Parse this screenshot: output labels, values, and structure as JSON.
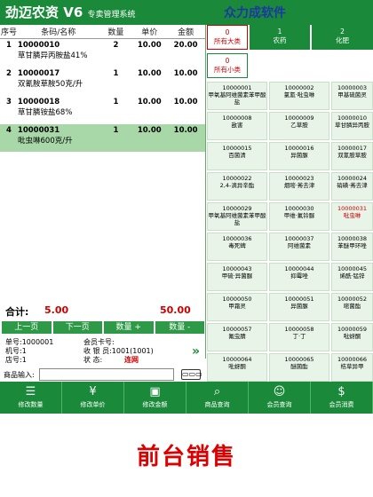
{
  "header": {
    "logo": "劲迈农资",
    "version": "V6",
    "system": "专卖管理系统",
    "brand": "众力成软件"
  },
  "table": {
    "columns": [
      "序号",
      "条码/名称",
      "数量",
      "单价",
      "金额"
    ],
    "rows": [
      {
        "seq": "1",
        "code": "10000010",
        "name": "草甘膦异丙胺盐41%",
        "qty": "2",
        "price": "10.00",
        "amount": "20.00"
      },
      {
        "seq": "2",
        "code": "10000017",
        "name": "双氰胺草胺50克/升",
        "qty": "1",
        "price": "10.00",
        "amount": "10.00"
      },
      {
        "seq": "3",
        "code": "10000018",
        "name": "草甘膦铵盐68%",
        "qty": "1",
        "price": "10.00",
        "amount": "10.00"
      },
      {
        "seq": "4",
        "code": "10000031",
        "name": "吡虫啉600克/升",
        "qty": "1",
        "price": "10.00",
        "amount": "10.00"
      }
    ]
  },
  "summary": {
    "label": "合计:",
    "qty": "5.00",
    "amount": "50.00"
  },
  "buttons": [
    "上一页",
    "下一页",
    "数量 +",
    "数量 -"
  ],
  "info": {
    "order": "单号:1000001",
    "machine": "机号:1",
    "store": "店号:1",
    "member_card": "会员卡号:",
    "cashier": "收 银 员:1001(1001)",
    "status_label": "状    态:",
    "status_value": "连网"
  },
  "input": {
    "label": "商品输入:",
    "keyboard": "▭▭▭"
  },
  "categories": [
    {
      "num": "0",
      "label": "所有大类"
    },
    {
      "num": "1",
      "label": "农药"
    },
    {
      "num": "2",
      "label": "化肥"
    }
  ],
  "subcategory": {
    "num": "0",
    "label": "所有小类"
  },
  "products": [
    {
      "code": "10000001",
      "name": "甲氧基阿维菌素苯甲酸盐"
    },
    {
      "code": "10000002",
      "name": "氯氰·吡虫啉"
    },
    {
      "code": "10000003",
      "name": "甲基硫菌灵"
    },
    {
      "code": "10000008",
      "name": "敌害"
    },
    {
      "code": "10000009",
      "name": "乙草胺"
    },
    {
      "code": "10000010",
      "name": "草甘膦异丙胺"
    },
    {
      "code": "10000015",
      "name": "百菌清"
    },
    {
      "code": "10000016",
      "name": "异菌脲"
    },
    {
      "code": "10000017",
      "name": "双氰胺草胺"
    },
    {
      "code": "10000022",
      "name": "2,4-滴异辛酯"
    },
    {
      "code": "10000023",
      "name": "烟嘧·莠去津"
    },
    {
      "code": "10000024",
      "name": "硝磺·莠去津"
    },
    {
      "code": "10000029",
      "name": "甲氧基阿维菌素苯甲酸盐"
    },
    {
      "code": "10000030",
      "name": "甲维·氟铃脲"
    },
    {
      "code": "10000031",
      "name": "吡虫啉"
    },
    {
      "code": "10000036",
      "name": "毒死蜱"
    },
    {
      "code": "10000037",
      "name": "阿维菌素"
    },
    {
      "code": "10000038",
      "name": "苯醚甲环唑"
    },
    {
      "code": "10000043",
      "name": "甲硫·异菌脲"
    },
    {
      "code": "10000044",
      "name": "抑霉唑"
    },
    {
      "code": "10000045",
      "name": "烯酰·锰锌"
    },
    {
      "code": "10000050",
      "name": "甲霜灵"
    },
    {
      "code": "10000051",
      "name": "异菌脲"
    },
    {
      "code": "10000052",
      "name": "嘧菌酯"
    },
    {
      "code": "10000057",
      "name": "氟虫腈"
    },
    {
      "code": "10000058",
      "name": "丁·丁"
    },
    {
      "code": "10000059",
      "name": "吡蚜酮"
    },
    {
      "code": "10000064",
      "name": "吡蚜酮"
    },
    {
      "code": "10000065",
      "name": "醚菌酯"
    },
    {
      "code": "10000066",
      "name": "桔草异甲"
    }
  ],
  "toolbar": [
    {
      "icon": "☰",
      "label": "修改数量"
    },
    {
      "icon": "¥",
      "label": "修改单价"
    },
    {
      "icon": "▣",
      "label": "修改金额"
    },
    {
      "icon": "⌕",
      "label": "商品查询"
    },
    {
      "icon": "☺",
      "label": "会员查询"
    },
    {
      "icon": "$",
      "label": "会员消费"
    }
  ],
  "caption": "前台销售",
  "colors": {
    "primary": "#1a8a3a",
    "accent": "#cc0000",
    "brand": "#1a3aa0",
    "selected": "#a8d8a8"
  }
}
